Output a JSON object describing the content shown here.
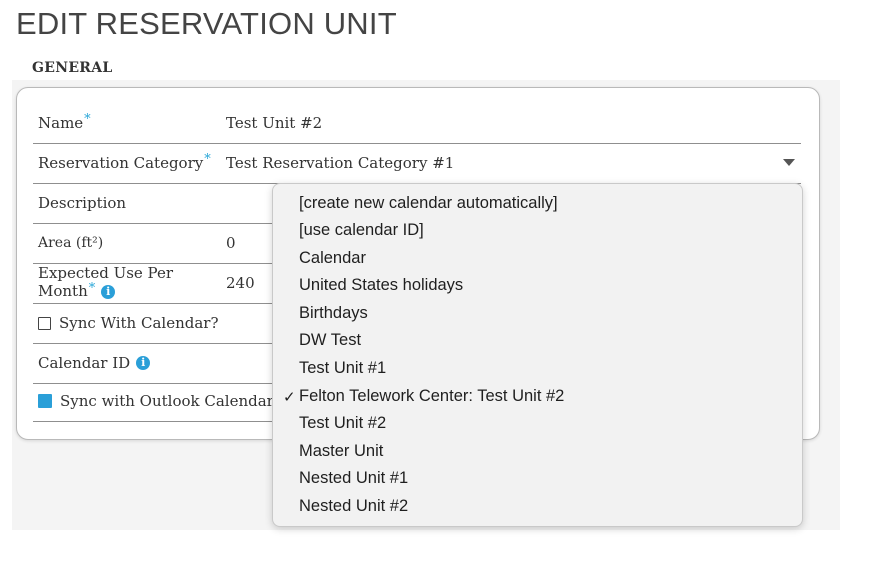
{
  "page": {
    "title": "EDIT RESERVATION UNIT"
  },
  "section": {
    "title": "GENERAL"
  },
  "form": {
    "name_label": "Name",
    "name_value": "Test Unit #2",
    "category_label": "Reservation Category",
    "category_value": "Test Reservation Category #1",
    "description_label": "Description",
    "area_label": "Area (ft²)",
    "area_value": "0",
    "expected_use_label_line1": "Expected Use Per",
    "expected_use_label_line2": "Month",
    "expected_use_value": "240",
    "sync_calendar_label": "Sync With Calendar?",
    "sync_calendar_checked": false,
    "calendar_id_label": "Calendar ID",
    "sync_outlook_label": "Sync with Outlook Calendar:",
    "sync_outlook_checked": true,
    "required_marker": "*",
    "info_glyph": "i"
  },
  "dropdown": {
    "items": [
      {
        "label": "[create new calendar automatically]",
        "selected": false
      },
      {
        "label": "[use calendar ID]",
        "selected": false
      },
      {
        "label": "Calendar",
        "selected": false
      },
      {
        "label": "United States holidays",
        "selected": false
      },
      {
        "label": "Birthdays",
        "selected": false
      },
      {
        "label": "DW Test",
        "selected": false
      },
      {
        "label": "Test Unit #1",
        "selected": false
      },
      {
        "label": "Felton Telework Center: Test Unit #2",
        "selected": true
      },
      {
        "label": "Test Unit #2",
        "selected": false
      },
      {
        "label": "Master Unit",
        "selected": false
      },
      {
        "label": "Nested Unit #1",
        "selected": false
      },
      {
        "label": "Nested Unit #2",
        "selected": false
      }
    ],
    "check_glyph": "✓"
  },
  "colors": {
    "accent": "#2a9fd8",
    "required": "#2aa7d8",
    "dropdown_bg": "#f2f2f2"
  }
}
